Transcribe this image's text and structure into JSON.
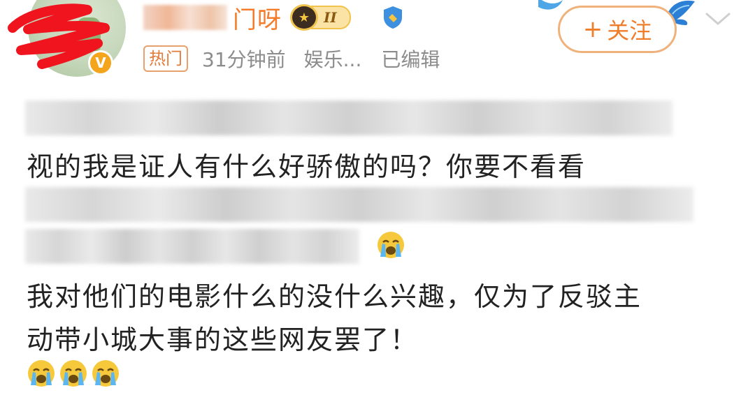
{
  "header": {
    "username_visible_suffix": "门呀",
    "level_badge": "II",
    "follow_label": "关注",
    "follow_plus": "+"
  },
  "meta": {
    "hot_tag": "热门",
    "time": "31分钟前",
    "source": "娱乐...",
    "edited": "已编辑"
  },
  "post": {
    "lines": [
      "视的我是证人有什么好骄傲的吗？你要不看看",
      "我对他们的电影什么的没什么兴趣，仅为了反驳主",
      "动带小城大事的这些网友罢了！"
    ]
  },
  "icons": {
    "verified": "verified-v-icon",
    "shield": "shield-icon",
    "chevron": "chevron-down-icon",
    "emoji": "crying-face-icon"
  },
  "colors": {
    "accent_orange": "#ef7d2a",
    "meta_gray": "#8c8c8c",
    "text_dark": "#222222"
  }
}
